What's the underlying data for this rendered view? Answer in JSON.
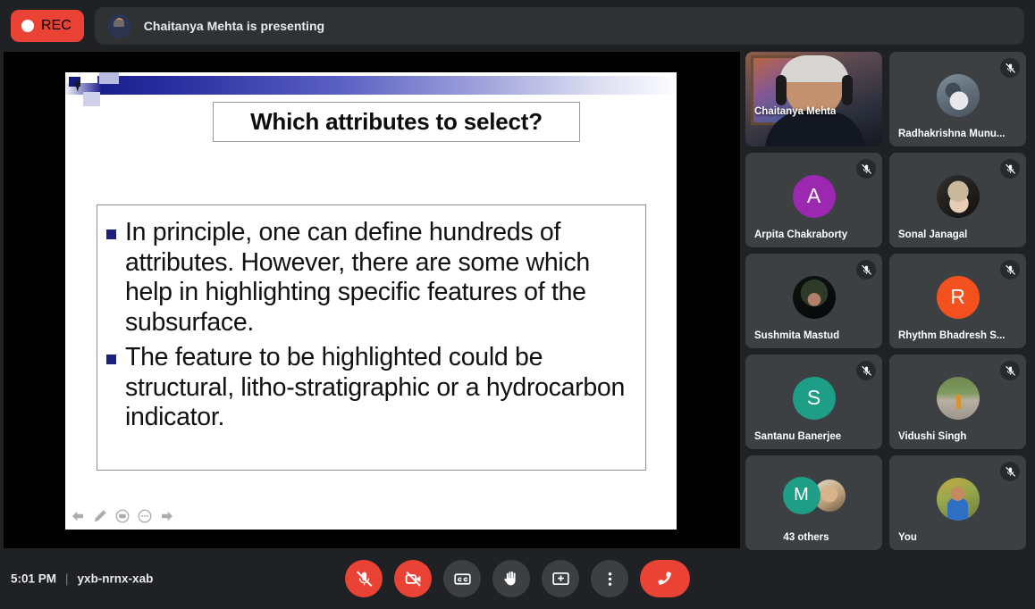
{
  "topbar": {
    "rec_label": "REC",
    "rec_icon": "record-dot-icon",
    "presenting_text": "Chaitanya Mehta is presenting",
    "presenter_thumb_icon": "presenter-avatar-icon"
  },
  "slide": {
    "title": "Which attributes to select?",
    "bullets": [
      "In principle, one can define hundreds of attributes. However, there are some which help in highlighting specific features of the subsurface.",
      "The feature to be highlighted could be structural, litho-stratigraphic or a hydrocarbon indicator."
    ],
    "nav": [
      {
        "name": "previous-slide-arrow-icon",
        "icon": "arrow-left-icon"
      },
      {
        "name": "pen-tool-icon",
        "icon": "pen-icon"
      },
      {
        "name": "slide-menu-icon",
        "icon": "screen-icon"
      },
      {
        "name": "more-options-icon",
        "icon": "ellipsis-icon"
      },
      {
        "name": "next-slide-arrow-icon",
        "icon": "arrow-right-icon"
      }
    ],
    "colors": {
      "accent": "#1b1f7d",
      "bullet": "#1b1f7d"
    }
  },
  "participants": [
    {
      "name": "Chaitanya Mehta",
      "kind": "video",
      "muted": false,
      "avatar_type": "video-feed"
    },
    {
      "name": "Radhakrishna Munu...",
      "kind": "photo",
      "muted": true,
      "avatar_type": "photo",
      "photo_class": "ph-radha"
    },
    {
      "name": "Arpita Chakraborty",
      "kind": "letter",
      "muted": true,
      "avatar_type": "letter",
      "letter": "A",
      "color": "#9c27b0"
    },
    {
      "name": "Sonal Janagal",
      "kind": "photo",
      "muted": true,
      "avatar_type": "photo",
      "photo_class": "ph-sonal"
    },
    {
      "name": "Sushmita Mastud",
      "kind": "photo",
      "muted": true,
      "avatar_type": "photo",
      "photo_class": "ph-sushmita"
    },
    {
      "name": "Rhythm Bhadresh S...",
      "kind": "letter",
      "muted": true,
      "avatar_type": "letter",
      "letter": "R",
      "color": "#f4511e"
    },
    {
      "name": "Santanu Banerjee",
      "kind": "letter",
      "muted": true,
      "avatar_type": "letter",
      "letter": "S",
      "color": "#1e9e87"
    },
    {
      "name": "Vidushi Singh",
      "kind": "photo",
      "muted": true,
      "avatar_type": "photo",
      "photo_class": "ph-vidushi"
    },
    {
      "name": "43 others",
      "kind": "others",
      "muted": false,
      "avatar_type": "stacked",
      "letter": "M",
      "color": "#1e9e87"
    },
    {
      "name": "You",
      "kind": "photo",
      "muted": true,
      "avatar_type": "photo",
      "photo_class": "ph-you"
    }
  ],
  "bottombar": {
    "time": "5:01 PM",
    "separator": "|",
    "meeting_code": "yxb-nrnx-xab",
    "controls": [
      {
        "name": "microphone-off-button",
        "icon": "mic-off-icon",
        "state": "off",
        "color": "#ea4335"
      },
      {
        "name": "camera-off-button",
        "icon": "camera-off-icon",
        "state": "off",
        "color": "#ea4335"
      },
      {
        "name": "captions-button",
        "icon": "closed-captions-icon",
        "state": "default",
        "color": "#3c4043"
      },
      {
        "name": "raise-hand-button",
        "icon": "raised-hand-icon",
        "state": "default",
        "color": "#3c4043"
      },
      {
        "name": "present-screen-button",
        "icon": "present-screen-icon",
        "state": "default",
        "color": "#3c4043"
      },
      {
        "name": "more-options-button",
        "icon": "vertical-ellipsis-icon",
        "state": "default",
        "color": "#3c4043"
      },
      {
        "name": "end-call-button",
        "icon": "end-call-icon",
        "state": "default",
        "color": "#ea4335"
      }
    ]
  }
}
